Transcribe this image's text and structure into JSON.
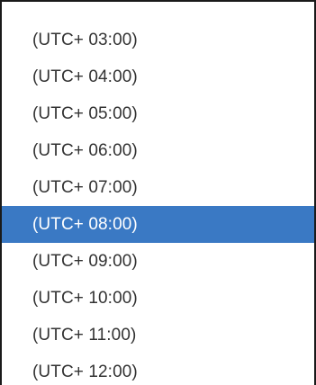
{
  "timezone_dropdown": {
    "selected_index": 5,
    "options": [
      {
        "label": "(UTC+ 03:00)"
      },
      {
        "label": "(UTC+ 04:00)"
      },
      {
        "label": "(UTC+ 05:00)"
      },
      {
        "label": "(UTC+ 06:00)"
      },
      {
        "label": "(UTC+ 07:00)"
      },
      {
        "label": "(UTC+ 08:00)"
      },
      {
        "label": "(UTC+ 09:00)"
      },
      {
        "label": "(UTC+ 10:00)"
      },
      {
        "label": "(UTC+ 11:00)"
      },
      {
        "label": "(UTC+ 12:00)"
      }
    ]
  },
  "colors": {
    "selected_background": "#3a79c4",
    "selected_text": "#ffffff",
    "option_text": "#333333",
    "border": "#1a1a1a"
  }
}
